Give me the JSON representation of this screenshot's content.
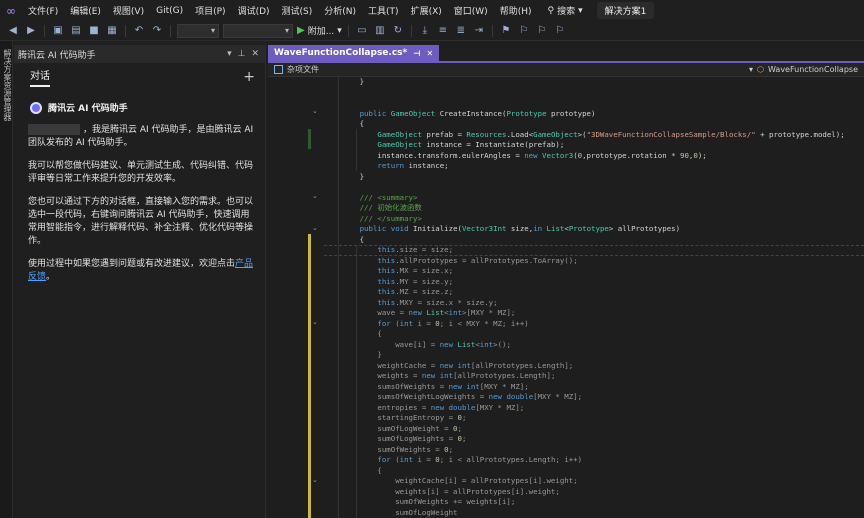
{
  "menubar": {
    "items": [
      "文件(F)",
      "编辑(E)",
      "视图(V)",
      "Git(G)",
      "项目(P)",
      "调试(D)",
      "测试(S)",
      "分析(N)",
      "工具(T)",
      "扩展(X)",
      "窗口(W)",
      "帮助(H)"
    ],
    "search_label": "搜索",
    "solution_label": "解决方案1"
  },
  "toolbar": {
    "attach_label": "附加..."
  },
  "left_strip": {
    "label": "解决方案资源管理器"
  },
  "assistant": {
    "panel_title": "腾讯云 AI 代码助手",
    "chat_tab": "对话",
    "new_chat": "+",
    "bot_name": "腾讯云 AI 代码助手",
    "messages": {
      "m1": "，我是腾讯云 AI 代码助手，是由腾讯云 AI 团队发布的 AI 代码助手。",
      "m2": "我可以帮您做代码建议、单元测试生成、代码纠错、代码评审等日常工作来提升您的开发效率。",
      "m3": "您也可以通过下方的对话框，直接输入您的需求。也可以选中一段代码，右键询问腾讯云 AI 代码助手，快速调用常用智能指令，进行解释代码、补全注释、优化代码等操作。",
      "m4_text": "使用过程中如果您遇到问题或有改进建议，欢迎点击",
      "m4_link": "产品反馈",
      "m4_end": "。"
    }
  },
  "editor": {
    "tab_name": "WaveFunctionCollapse.cs*",
    "nav_left": "杂项文件",
    "nav_right": "WaveFunctionCollapse"
  },
  "code_lines": [
    "        }",
    "",
    "",
    "        public GameObject CreateInstance(Prototype prototype)",
    "        {",
    "            GameObject prefab = Resources.Load<GameObject>(\"3DWaveFunctionCollapseSample/Blocks/\" + prototype.model);",
    "            GameObject instance = Instantiate(prefab);",
    "            instance.transform.eulerAngles = new Vector3(0,prototype.rotation * 90,0);",
    "            return instance;",
    "        }",
    "",
    "        /// <summary>",
    "        /// 初始化波函数",
    "        /// </summary>",
    "        public void Initialize(Vector3Int size,in List<Prototype> allPrototypes)",
    "        {",
    "            this.size = size;",
    "            this.allPrototypes = allPrototypes.ToArray();",
    "            this.MX = size.x;",
    "            this.MY = size.y;",
    "            this.MZ = size.z;",
    "            this.MXY = size.x * size.y;",
    "            wave = new List<int>[MXY * MZ];",
    "            for (int i = 0; i < MXY * MZ; i++)",
    "            {",
    "                wave[i] = new List<int>();",
    "            }",
    "            weightCache = new int[allPrototypes.Length];",
    "            weights = new int[allPrototypes.Length];",
    "            sumsOfWeights = new int[MXY * MZ];",
    "            sumsOfWeightLogWeights = new double[MXY * MZ];",
    "            entropies = new double[MXY * MZ];",
    "            startingEntropy = 0;",
    "            sumOfLogWeight = 0;",
    "            sumOfLogWeights = 0;",
    "            sumOfWeights = 0;",
    "            for (int i = 0; i < allPrototypes.Length; i++)",
    "            {",
    "                weightCache[i] = allPrototypes[i].weight;",
    "                weights[i] = allPrototypes[i].weight;",
    "                sumOfWeights += weights[i];",
    "                sumOfLogWeight",
    "            }"
  ]
}
